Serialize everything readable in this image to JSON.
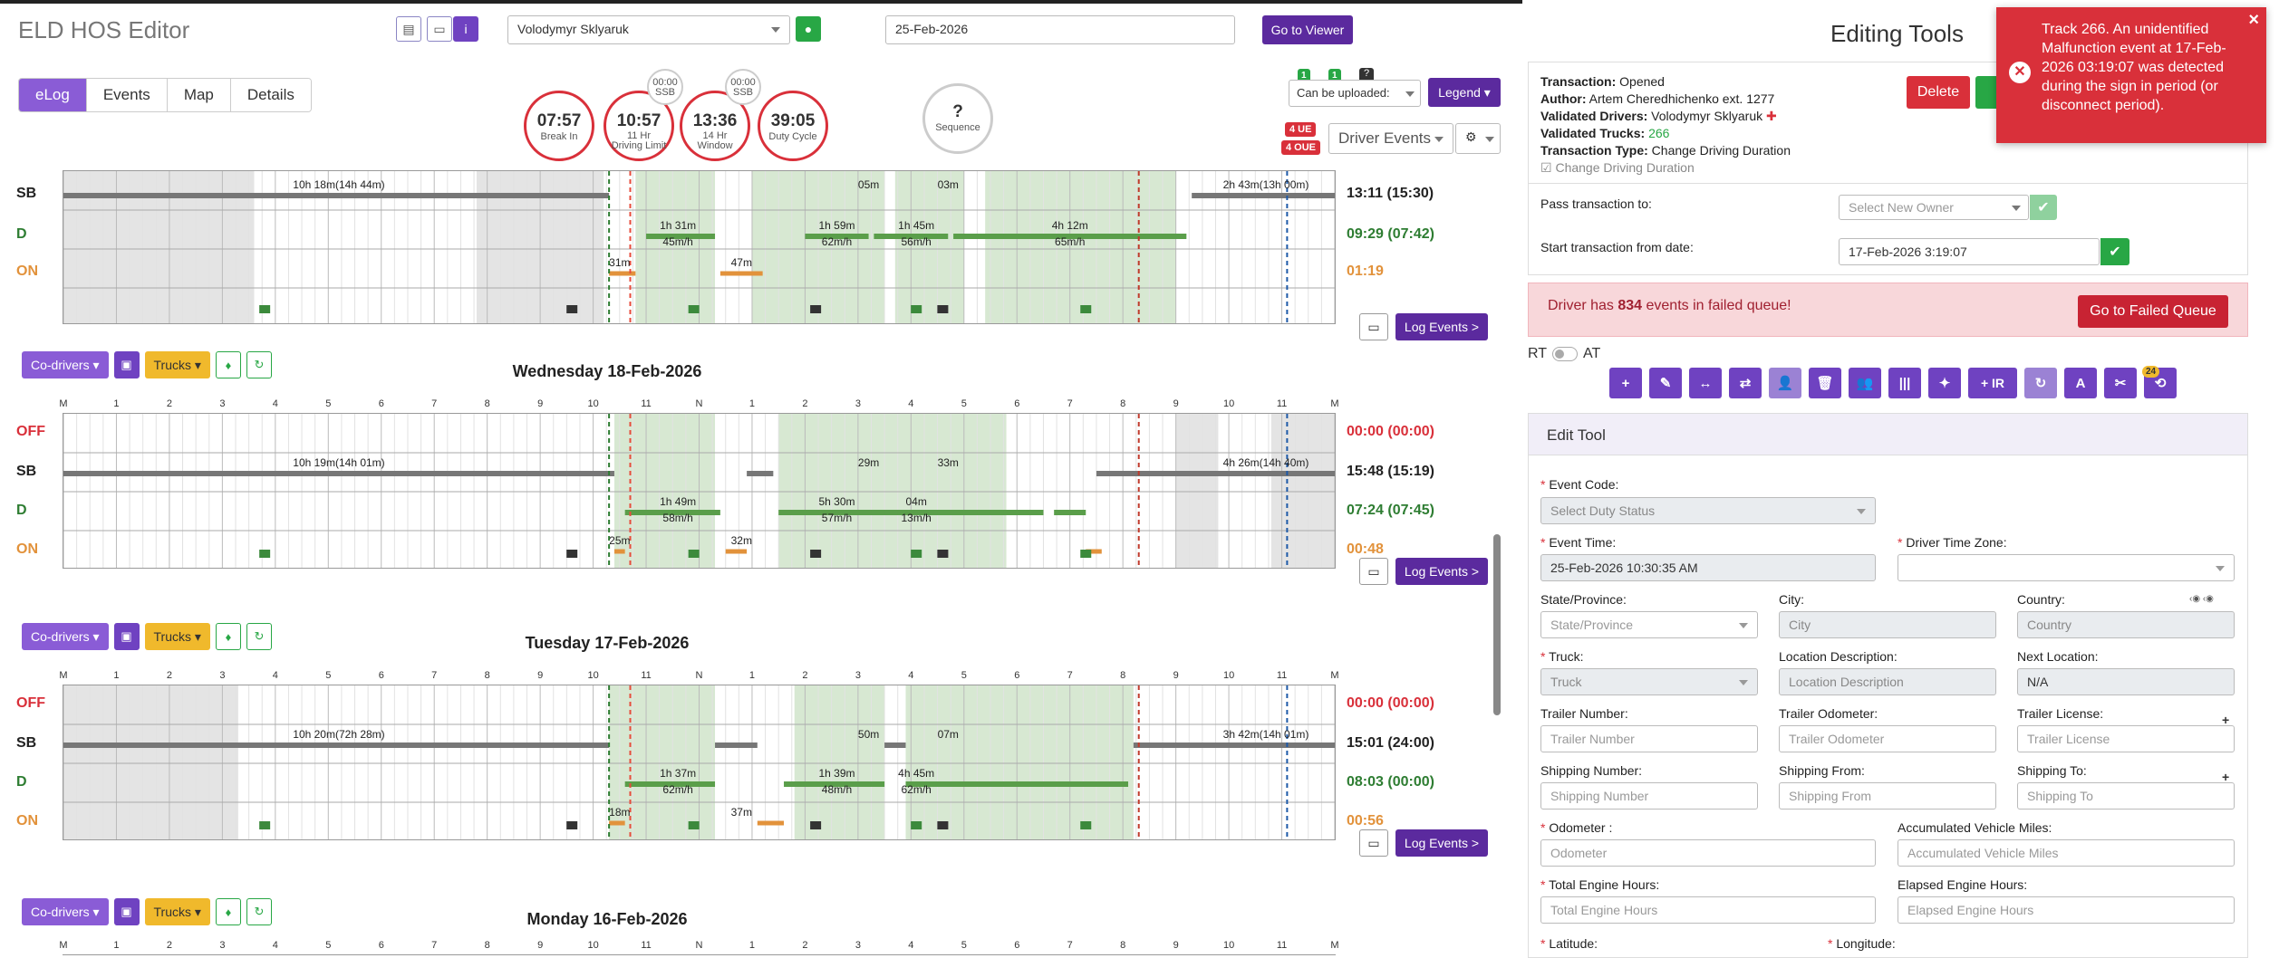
{
  "app": {
    "title": "ELD HOS Editor"
  },
  "header": {
    "driver": "Volodymyr Sklyaruk",
    "date": "25-Feb-2026",
    "viewer_btn": "Go to Viewer"
  },
  "tabs": [
    "eLog",
    "Events",
    "Map",
    "Details"
  ],
  "gauges": [
    {
      "value": "07:57",
      "label": "Break In"
    },
    {
      "value": "10:57",
      "label": "11 Hr\nDriving Limit"
    },
    {
      "value": "13:36",
      "label": "14 Hr\nWindow"
    },
    {
      "value": "39:05",
      "label": "Duty Cycle"
    },
    {
      "value": "?",
      "label": "Sequence"
    }
  ],
  "minigauges": [
    {
      "value": "00:00",
      "label": "SSB"
    },
    {
      "value": "00:00",
      "label": "SSB"
    }
  ],
  "top_right": {
    "upload_select": "Can be uploaded:",
    "legend": "Legend",
    "ue": "4 UE",
    "oue": "4 OUE",
    "driver_events": "Driver Events",
    "b1": "1",
    "b2": "1",
    "help": "?"
  },
  "rows": {
    "off": "OFF",
    "sb": "SB",
    "d": "D",
    "on": "ON"
  },
  "hour_labels": [
    "M",
    "1",
    "2",
    "3",
    "4",
    "5",
    "6",
    "7",
    "8",
    "9",
    "10",
    "11",
    "N",
    "1",
    "2",
    "3",
    "4",
    "5",
    "6",
    "7",
    "8",
    "9",
    "10",
    "11",
    "M"
  ],
  "controls": {
    "codrivers": "Co-drivers",
    "trucks": "Trucks",
    "log_events": "Log Events"
  },
  "days": [
    {
      "title": "",
      "totals": {
        "off": "",
        "sb": "13:11 (15:30)",
        "d": "09:29 (07:42)",
        "on": "01:19"
      },
      "labels": {
        "sb1": "10h 18m(14h 44m)",
        "sb2": "2h 43m(13h 00m)",
        "on1": "31m",
        "on2": "47m",
        "d1": "1h 31m",
        "d1b": "45m/h",
        "d2": "1h 59m",
        "d2b": "62m/h",
        "d3": "1h 45m",
        "d3b": "56m/h",
        "d4": "4h 12m",
        "d4b": "65m/h",
        "sb3": "05m",
        "sb4": "03m"
      }
    },
    {
      "title": "Wednesday 18-Feb-2026",
      "totals": {
        "off": "00:00 (00:00)",
        "sb": "15:48 (15:19)",
        "d": "07:24 (07:45)",
        "on": "00:48"
      },
      "labels": {
        "sb1": "10h 19m(14h 01m)",
        "sb2": "4h 26m(14h 40m)",
        "on1": "25m",
        "on2": "32m",
        "d1": "1h 49m",
        "d1b": "58m/h",
        "d2": "5h 30m",
        "d2b": "57m/h",
        "sb3": "29m",
        "sb4": "33m",
        "d3": "04m",
        "d3b": "13m/h"
      }
    },
    {
      "title": "Tuesday 17-Feb-2026",
      "totals": {
        "off": "00:00 (00:00)",
        "sb": "15:01 (24:00)",
        "d": "08:03 (00:00)",
        "on": "00:56"
      },
      "labels": {
        "sb1": "10h 20m(72h 28m)",
        "sb2": "3h 42m(14h 01m)",
        "on1": "18m",
        "on2": "37m",
        "d1": "1h 37m",
        "d1b": "62m/h",
        "d2": "1h 39m",
        "d2b": "48m/h",
        "d3": "4h 45m",
        "d3b": "62m/h",
        "sb3": "50m",
        "sb4": "07m"
      }
    },
    {
      "title": "Monday 16-Feb-2026"
    }
  ],
  "right": {
    "title": "Editing Tools",
    "transaction": {
      "status_k": "Transaction:",
      "status": "Opened",
      "author_k": "Author:",
      "author": "Artem Cheredhichenko ext. 1277",
      "vd_k": "Validated Drivers:",
      "vd": "Volodymyr Sklyaruk",
      "vt_k": "Validated Trucks:",
      "vt": "266",
      "tt_k": "Transaction Type:",
      "tt": "Change Driving Duration",
      "chk": "Change Driving Duration"
    },
    "delete_btn": "Delete",
    "pass_label": "Pass transaction to:",
    "pass_placeholder": "Select New Owner",
    "start_label": "Start transaction from date:",
    "start_value": "17-Feb-2026 3:19:07",
    "alert_pre": "Driver has ",
    "alert_num": "834",
    "alert_post": " events in failed queue!",
    "queue_btn": "Go to Failed Queue",
    "rt": "RT",
    "at": "AT",
    "tools": [
      "+",
      "✎",
      "↔",
      "⇄",
      "👤",
      "🗑",
      "👥",
      "|||",
      "✦",
      "+ IR",
      "↻",
      "A",
      "✂",
      "⟲"
    ],
    "tool_badge": "24",
    "edit_tool": "Edit Tool",
    "fields": {
      "event_code": "Event Code:",
      "event_code_ph": "Select Duty Status",
      "event_time": "Event Time:",
      "event_time_val": "25-Feb-2026 10:30:35 AM",
      "tz": "Driver Time Zone:",
      "state": "State/Province:",
      "state_ph": "State/Province",
      "city": "City:",
      "city_ph": "City",
      "country": "Country:",
      "country_ph": "Country",
      "truck": "Truck:",
      "truck_ph": "Truck",
      "locdesc": "Location Description:",
      "locdesc_ph": "Location Description",
      "nextloc": "Next Location:",
      "nextloc_val": "N/A",
      "trailer_num": "Trailer Number:",
      "trailer_num_ph": "Trailer Number",
      "trailer_odo": "Trailer Odometer:",
      "trailer_odo_ph": "Trailer Odometer",
      "trailer_lic": "Trailer License:",
      "trailer_lic_ph": "Trailer License",
      "ship_num": "Shipping Number:",
      "ship_num_ph": "Shipping Number",
      "ship_from": "Shipping From:",
      "ship_from_ph": "Shipping From",
      "ship_to": "Shipping To:",
      "ship_to_ph": "Shipping To",
      "odometer": "Odometer :",
      "odometer_ph": "Odometer",
      "avm": "Accumulated Vehicle Miles:",
      "avm_ph": "Accumulated Vehicle Miles",
      "teh": "Total Engine Hours:",
      "teh_ph": "Total Engine Hours",
      "eeh": "Elapsed Engine Hours:",
      "eeh_ph": "Elapsed Engine Hours",
      "lat": "Latitude:",
      "lon": "Longitude:"
    }
  },
  "toast": {
    "text": "Track 266. An unidentified Malfunction event at 17-Feb-2026 03:19:07 was detected during the sign in period (or disconnect period)."
  },
  "colors": {
    "purple": "#6f42c1",
    "green": "#28a745",
    "red": "#d9303a",
    "orange": "#f0b92c",
    "driving": "#5a9e4a",
    "on": "#e2923b"
  }
}
